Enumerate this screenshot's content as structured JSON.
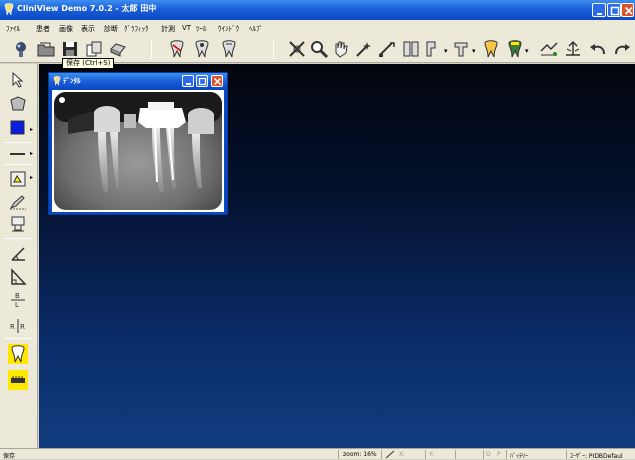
{
  "window": {
    "title": "CliniView Demo 7.0.2 - 太郎 田中",
    "minimize_label": "",
    "maximize_label": "",
    "close_label": ""
  },
  "menu": [
    "ﾌｧｲﾙ",
    "患者",
    "画像",
    "表示",
    "診断",
    "ｸﾞﾗﾌｨｯｸ",
    "計測",
    "VT",
    "ﾂｰﾙ",
    "ｳｲﾝﾄﾞｳ",
    "ﾍﾙﾌﾟ"
  ],
  "toolbar": {
    "tooltip": "保存 (Ctrl+S)",
    "icons": [
      "acquire-icon",
      "open-icon",
      "save-icon",
      "copy-icon",
      "print-icon",
      "tooth-1-icon",
      "tooth-2-icon",
      "tooth-3-icon",
      "crosshair-icon",
      "zoom-icon",
      "hand-icon",
      "magic-icon",
      "measure-icon",
      "tooth-arrange-icon",
      "layout-1-icon",
      "layout-2-icon",
      "tooth-color-icon",
      "tooth-yellow-icon",
      "compare-icon",
      "adjust-icon",
      "undo-icon",
      "redo-icon"
    ]
  },
  "palette": {
    "tools": [
      "pointer-icon",
      "shape-icon",
      "color-swatch-icon",
      "line-style-icon",
      "annotate-icon",
      "pencil-icon",
      "stamp-icon",
      "angle-icon",
      "triangle-icon",
      "ratio-icon",
      "mirror-icon",
      "tooth-highlight-icon",
      "ruler-highlight-icon"
    ],
    "ratio_label": "B\nL",
    "mirror_label": "R|R"
  },
  "image_window": {
    "title": "ﾃﾞﾝﾀﾙ"
  },
  "status": {
    "left": "保存",
    "zoom": "zoom: 16%",
    "x_label": "X:",
    "y_label": "Y:",
    "o_label": "O",
    "p_label": "P",
    "battery": "ﾊﾞｯﾃﾘｰ",
    "user": "ﾕｰｻﾞｰ: PIDBDefaul"
  },
  "colors": {
    "title_blue": "#0a49c4",
    "close_red": "#d9532c",
    "workspace_top": "#02050d",
    "workspace_bottom": "#123c80",
    "highlight_yellow": "#ffe800"
  }
}
